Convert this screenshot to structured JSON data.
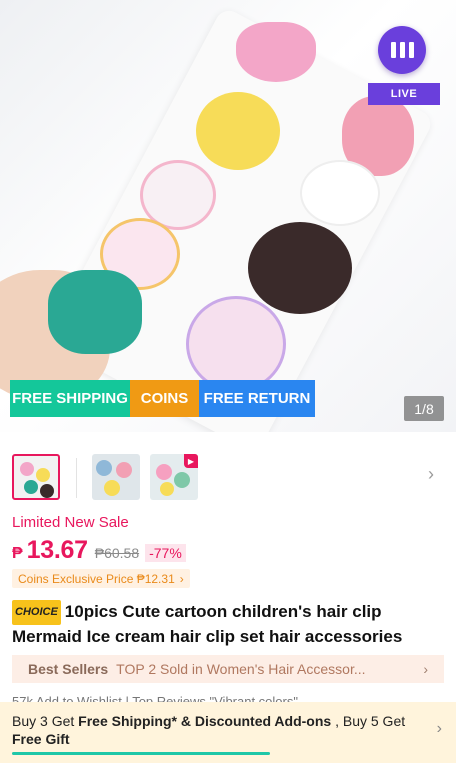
{
  "hero": {
    "live_label": "LIVE",
    "promo_tags": [
      "FREE SHIPPING",
      "COINS",
      "FREE RETURN"
    ],
    "image_counter": "1/8"
  },
  "thumbnails": {
    "count": 3,
    "selected_index": 0
  },
  "price": {
    "sale_label": "Limited New Sale",
    "currency": "₱",
    "current": "13.67",
    "original": "₱60.58",
    "discount": "-77%",
    "coins_price": "Coins Exclusive Price ₱12.31",
    "coins_arrow": "›"
  },
  "product": {
    "choice_tag": "CHOICE",
    "title": "10pics Cute cartoon children's hair clip Mermaid Ice cream hair clip set hair accessories"
  },
  "best_sellers": {
    "label": "Best Sellers",
    "text": "TOP 2 Sold in Women's Hair Accessor...",
    "arrow": "›"
  },
  "stats": {
    "text": "57k   Add to Wishlist   |   Top Reviews \"Vibrant colors\""
  },
  "shipping_promo": {
    "part1": "Buy 3 Get ",
    "bold1": "Free Shipping* & Discounted Add-ons",
    "part2": " , Buy 5 Get ",
    "bold2": "Free Gift",
    "arrow": "›"
  },
  "colors": {
    "accent": "#e8175d",
    "live": "#6a3fdc",
    "free_shipping": "#14c79a",
    "coins": "#f09a14",
    "free_return": "#2a86f0"
  }
}
